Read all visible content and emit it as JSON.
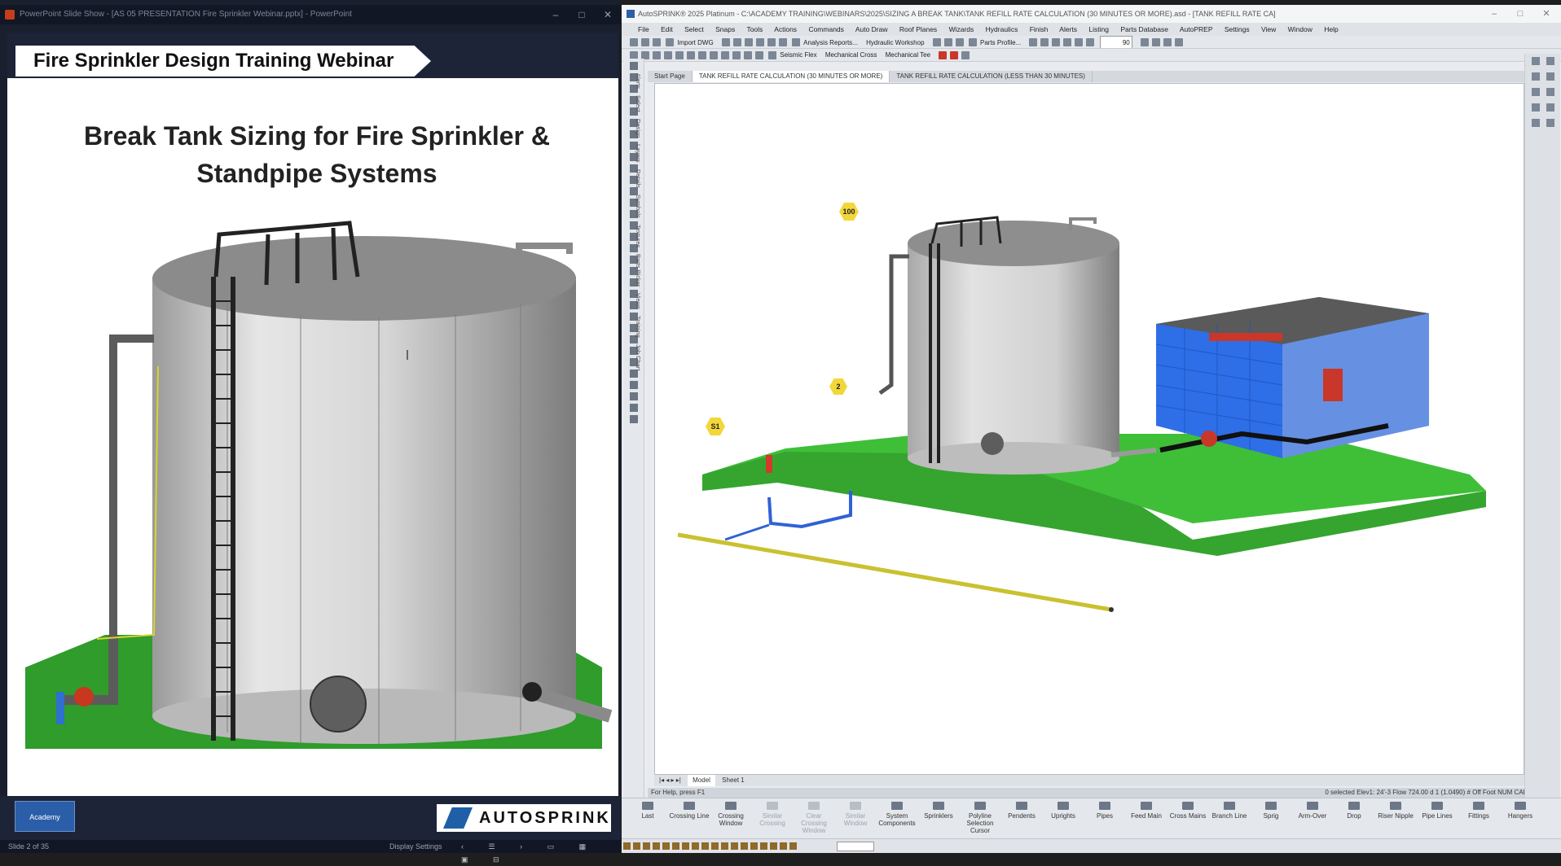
{
  "powerpoint": {
    "window_title": "PowerPoint Slide Show - [AS 05 PRESENTATION Fire Sprinkler Webinar.pptx] - PowerPoint",
    "slide_header": "Fire Sprinkler Design Training Webinar",
    "slide_title_line1": "Break Tank Sizing for Fire Sprinkler &",
    "slide_title_line2": "Standpipe Systems",
    "academy_logo": "Academy",
    "autosprink_logo": "AUTOSPRINK",
    "status": {
      "slide_number": "Slide 2 of 35",
      "display_settings": "Display Settings"
    }
  },
  "autosprink": {
    "window_title": "AutoSPRINK® 2025 Platinum - C:\\ACADEMY TRAINING\\WEBINARS\\2025\\SIZING A BREAK TANK\\TANK REFILL RATE CALCULATION (30 MINUTES OR MORE).asd - [TANK REFILL RATE CA]",
    "menu": [
      "File",
      "Edit",
      "Select",
      "Snaps",
      "Tools",
      "Actions",
      "Commands",
      "Auto Draw",
      "Roof Planes",
      "Wizards",
      "Hydraulics",
      "Finish",
      "Alerts",
      "Listing",
      "Parts Database",
      "AutoPREP",
      "Settings",
      "View",
      "Window",
      "Help"
    ],
    "toolbar1": {
      "import_dwg": "Import DWG",
      "analysis_reports": "Analysis Reports...",
      "hydraulic_workshop": "Hydraulic Workshop",
      "parts_profile": "Parts Profile...",
      "zoom_value": "90"
    },
    "toolbar2": {
      "seismic_flex": "Seismic Flex",
      "mechanical_cross": "Mechanical Cross",
      "mechanical_tee": "Mechanical Tee"
    },
    "vertical_tabs": [
      "Alerts",
      "Select",
      "Design",
      "Layers",
      "Details",
      "Symbols",
      "Textures",
      "Parts Picker",
      "Views",
      "Training",
      "Job Chart"
    ],
    "doc_tabs": [
      "Start Page",
      "TANK REFILL RATE CALCULATION (30 MINUTES OR MORE)",
      "TANK REFILL RATE CALCULATION (LESS THAN 30 MINUTES)"
    ],
    "node_labels": [
      "100",
      "2",
      "S1"
    ],
    "sheet_tabs": [
      "Model",
      "Sheet 1"
    ],
    "status": {
      "help": "For Help, press F1",
      "right": "0 selected   Elev1: 24'-3   Flow 724.00   d 1 (1.0490)  # Off  Foot   NUM   CAP"
    },
    "bottom_tools": [
      {
        "label": "Last",
        "enabled": true
      },
      {
        "label": "Crossing Line",
        "enabled": true
      },
      {
        "label": "Crossing Window",
        "enabled": true
      },
      {
        "label": "Similar Crossing",
        "enabled": false
      },
      {
        "label": "Clear Crossing Window",
        "enabled": false
      },
      {
        "label": "Similar Window",
        "enabled": false
      },
      {
        "label": "System Components",
        "enabled": true
      },
      {
        "label": "Sprinklers",
        "enabled": true
      },
      {
        "label": "Polyline Selection Cursor",
        "enabled": true
      },
      {
        "label": "Pendents",
        "enabled": true
      },
      {
        "label": "Uprights",
        "enabled": true
      },
      {
        "label": "Pipes",
        "enabled": true
      },
      {
        "label": "Feed Main",
        "enabled": true
      },
      {
        "label": "Cross Mains",
        "enabled": true
      },
      {
        "label": "Branch Line",
        "enabled": true
      },
      {
        "label": "Sprig",
        "enabled": true
      },
      {
        "label": "Arm-Over",
        "enabled": true
      },
      {
        "label": "Drop",
        "enabled": true
      },
      {
        "label": "Riser Nipple",
        "enabled": true
      },
      {
        "label": "Pipe Lines",
        "enabled": true
      },
      {
        "label": "Fittings",
        "enabled": true
      },
      {
        "label": "Hangers",
        "enabled": true
      }
    ]
  }
}
